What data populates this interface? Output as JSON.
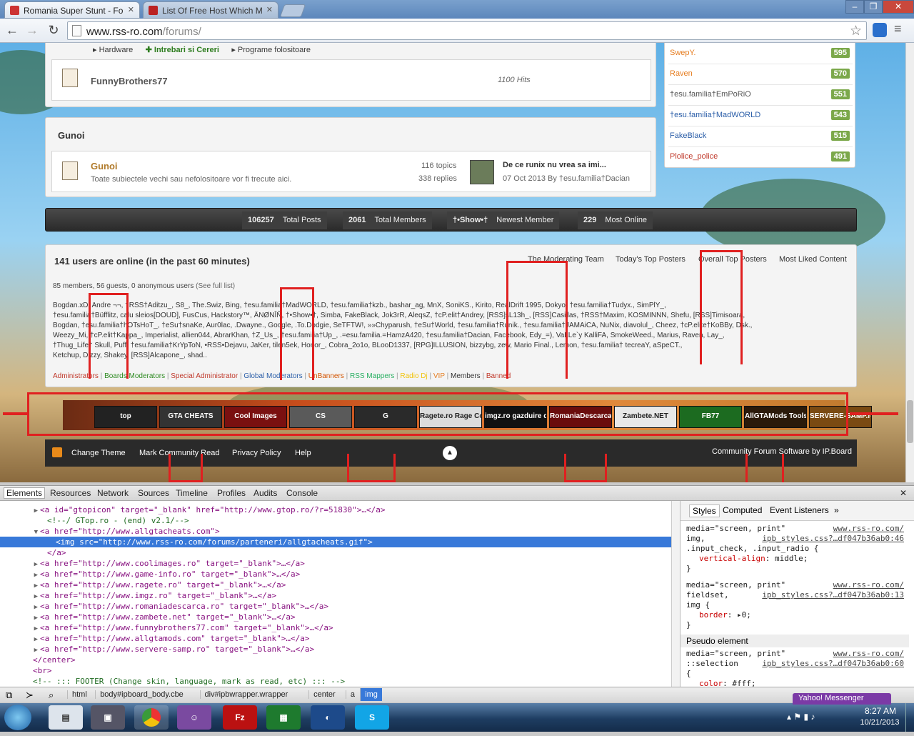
{
  "browser": {
    "tabs": [
      {
        "title": "Romania Super Stunt - Fo"
      },
      {
        "title": "List Of Free Host Which M"
      }
    ],
    "url_host": "www.rss-ro.com",
    "url_path": "/forums/"
  },
  "forum": {
    "top_links": [
      "Hardware",
      "Intrebari si Cereri",
      "Programe folositoare"
    ],
    "funny": {
      "name": "FunnyBrothers77",
      "hits": "1100 Hits"
    },
    "gunoi_header": "Gunoi",
    "gunoi": {
      "name": "Gunoi",
      "desc": "Toate subiectele vechi sau nefolositoare vor fi trecute aici.",
      "topics": "116 topics",
      "replies": "338 replies",
      "last_title": "De ce runix nu vrea sa imi...",
      "last_meta": "07 Oct 2013 By †esu.familia†Dacian"
    }
  },
  "top_posters": [
    {
      "name": "SwepY.",
      "value": "595"
    },
    {
      "name": "Raven",
      "value": "570"
    },
    {
      "name": "†esu.familia†EmPoRiO",
      "value": "551"
    },
    {
      "name": "†esu.familia†MadWORLD",
      "value": "543"
    },
    {
      "name": "FakeBlack",
      "value": "515"
    },
    {
      "name": "Plolice_police",
      "value": "491"
    }
  ],
  "stats": {
    "total_posts": "106257",
    "total_posts_label": "Total Posts",
    "total_members": "2061",
    "total_members_label": "Total Members",
    "newest_member": "†•Show•†",
    "newest_member_label": "Newest Member",
    "most_online": "229",
    "most_online_label": "Most Online"
  },
  "online": {
    "title": "141 users are online (in the past 60 minutes)",
    "tabs": [
      "The Moderating Team",
      "Today's Top Posters",
      "Overall Top Posters",
      "Most Liked Content"
    ],
    "summary": "85 members, 56 guests, 0 anonymous users",
    "full_list": "(See full list)",
    "names_lines": [
      "Bogdan.xD, Andre ¬¬, †RSS†Aditzu_, S8_, The.Swiz, Bing, †esu.familia†MadWORLD, †esu.familia†kzb., bashar_ag, MnX, SoniKS., Kirito, RealDrift 1995, Dokyo, †esu.familia†Tudyx., SimPlY_,",
      "†esu.familia†Büfflitz, calu sleios[DOUD], FusCus, Hackstory™, ÄNØNÎÑ, †•Show•†, Simba, FakeBlack, Jok3rR, AleqsZ, †cP.elit†Andrey, [RSS]sL13h_, [RSS]Casillas, †RSS†Maxim, KOSMINNN, Shefu, [RSS]Timisoara,",
      "Bogdan, †esu.familia†hOTsHoT_, †eSu†snaKe, Aur0lac, .Dwayne., Google, .To.Dodgie, SeTFTW!, »»Chyparush, †eSu†World, †esu.familia†Runik., †esu.familia†JAMAiCA, NuNix, diavolul_, Cheez, †cP.elite†KoBBy, Dsk.,",
      "Weezy_Mi, †cP.elit†Kappa_, Imperialist, allien044, AbrarKhan, †Z_Us_, †esu.familia†Up_, .=esu.familia.=HamzA420, †esu.familia†Dacian, Facebook, Edy_=), VaLLe`y KalliFA, SmokeWeed., Marius, Raven, Lay_,",
      "†Thug_Life† Skull, Puff, †esu.familia†KrYpToN, •RSS•Dejavu, JaKer, tilen5ek, Honor_, Cobra_2o1o, BLooD1337, [RPG]ILLUSION, bizzybg, zew, Mario Final., Lemon, †esu.familia† tecreaY, aSpeCT.,",
      "Ketchup, Dizzy, Shakey, [RSS]Alcapone_, shad.."
    ],
    "legend": [
      {
        "label": "Administrators",
        "color": "#c0392b"
      },
      {
        "label": "Boards Moderators",
        "color": "#2e8b22"
      },
      {
        "label": "Special Administrator",
        "color": "#c0392b"
      },
      {
        "label": "Global Moderators",
        "color": "#2b5ea8"
      },
      {
        "label": "UnBanners",
        "color": "#d35400"
      },
      {
        "label": "RSS Mappers",
        "color": "#27ae60"
      },
      {
        "label": "Radio Dj",
        "color": "#f1c40f"
      },
      {
        "label": "VIP",
        "color": "#e67e22"
      },
      {
        "label": "Members",
        "color": "#333333"
      },
      {
        "label": "Banned",
        "color": "#c0392b"
      }
    ]
  },
  "banners": [
    {
      "label": "top",
      "bg": "#222222"
    },
    {
      "label": "GTA CHEATS",
      "bg": "#333333"
    },
    {
      "label": "Cool Images",
      "bg": "#7a1010"
    },
    {
      "label": "CS",
      "bg": "#5a5a5a"
    },
    {
      "label": "G",
      "bg": "#2a2a2a"
    },
    {
      "label": "Ragete.ro Rage Comics",
      "bg": "#dcdcdc"
    },
    {
      "label": "imgz.ro gazduire de imagini",
      "bg": "#111111"
    },
    {
      "label": "RomaniaDescarca RO",
      "bg": "#6a0c0c"
    },
    {
      "label": "Zambete.NET",
      "bg": "#e8e8e8"
    },
    {
      "label": "FB77",
      "bg": "#1c6b20"
    },
    {
      "label": "AllGTAMods Tools",
      "bg": "#2b1a0a"
    },
    {
      "label": "SERVERE-SAMP.ro",
      "bg": "#7a4a12"
    }
  ],
  "footer": {
    "change_theme": "Change Theme",
    "mark_read": "Mark Community Read",
    "privacy": "Privacy Policy",
    "help": "Help",
    "credit": "Community Forum Software by IP.Board"
  },
  "devtools": {
    "tabs": [
      "Elements",
      "Resources",
      "Network",
      "Sources",
      "Timeline",
      "Profiles",
      "Audits",
      "Console"
    ],
    "dom_lines": [
      {
        "indent": 56,
        "arrow": "▶",
        "text": "<a id=\"gtopicon\" target=\"_blank\" href=\"http://www.gtop.ro/?r=51830\">…</a>",
        "sel": false
      },
      {
        "indent": 66,
        "arrow": "",
        "text": "<!--/ GTop.ro - (end) v2.1/-->",
        "sel": false
      },
      {
        "indent": 56,
        "arrow": "▼",
        "text": "<a href=\"http://www.allgtacheats.com\">",
        "sel": false
      },
      {
        "indent": 78,
        "arrow": "",
        "text": "<img src=\"http://www.rss-ro.com/forums/parteneri/allgtacheats.gif\">",
        "sel": true
      },
      {
        "indent": 66,
        "arrow": "",
        "text": "</a>",
        "sel": false
      },
      {
        "indent": 56,
        "arrow": "▶",
        "text": "<a href=\"http://www.coolimages.ro\" target=\"_blank\">…</a>",
        "sel": false
      },
      {
        "indent": 56,
        "arrow": "▶",
        "text": "<a href=\"http://www.game-info.ro\" target=\"_blank\">…</a>",
        "sel": false
      },
      {
        "indent": 56,
        "arrow": "▶",
        "text": "<a href=\"http://www.ragete.ro\" target=\"_blank\">…</a>",
        "sel": false
      },
      {
        "indent": 56,
        "arrow": "▶",
        "text": "<a href=\"http://www.imgz.ro\" target=\"_blank\">…</a>",
        "sel": false
      },
      {
        "indent": 56,
        "arrow": "▶",
        "text": "<a href=\"http://www.romaniadescarca.ro\" target=\"_blank\">…</a>",
        "sel": false
      },
      {
        "indent": 56,
        "arrow": "▶",
        "text": "<a href=\"http://www.zambete.net\" target=\"_blank\">…</a>",
        "sel": false
      },
      {
        "indent": 56,
        "arrow": "▶",
        "text": "<a href=\"http://www.funnybrothers77.com\" target=\"_blank\">…</a>",
        "sel": false
      },
      {
        "indent": 56,
        "arrow": "▶",
        "text": "<a href=\"http://www.allgtamods.com\" target=\"_blank\">…</a>",
        "sel": false
      },
      {
        "indent": 56,
        "arrow": "▶",
        "text": "<a href=\"http://www.servere-samp.ro\" target=\"_blank\">…</a>",
        "sel": false
      },
      {
        "indent": 46,
        "arrow": "",
        "text": "</center>",
        "sel": false
      },
      {
        "indent": 46,
        "arrow": "",
        "text": "<br>",
        "sel": false
      },
      {
        "indent": 46,
        "arrow": "",
        "text": "<!-- ::: FOOTER (Change skin, language, mark as read, etc) ::: -->",
        "sel": false
      }
    ],
    "side_tabs": [
      "Styles",
      "Computed",
      "Event Listeners",
      "»"
    ],
    "rules": [
      {
        "media": "media=\"screen, print\"",
        "src": "www.rss-ro.com/",
        "selector": "img,",
        "src2": "ipb_styles.css?…df047b36ab0:46",
        "extra": ".input_check, .input_radio {",
        "prop": "vertical-align",
        "val": "middle;"
      },
      {
        "media": "media=\"screen, print\"",
        "src": "www.rss-ro.com/",
        "selector": "fieldset,",
        "src2": "ipb_styles.css?…df047b36ab0:13",
        "extra": "img {",
        "prop": "border",
        "val": "▸0;"
      }
    ],
    "pseudo_header": "Pseudo element",
    "pseudo": {
      "media": "media=\"screen, print\"",
      "src": "www.rss-ro.com/",
      "selector": "::selection",
      "src2": "ipb_styles.css?…df047b36ab0:60",
      "prop": "color",
      "val": "#fff;"
    },
    "crumbs": [
      "html",
      "body#ipboard_body.cbe",
      "div#ipbwrapper.wrapper",
      "center",
      "a",
      "img"
    ]
  },
  "taskbar": {
    "messenger": "Yahoo! Messenger",
    "time": "8:27 AM",
    "date": "10/21/2013"
  }
}
